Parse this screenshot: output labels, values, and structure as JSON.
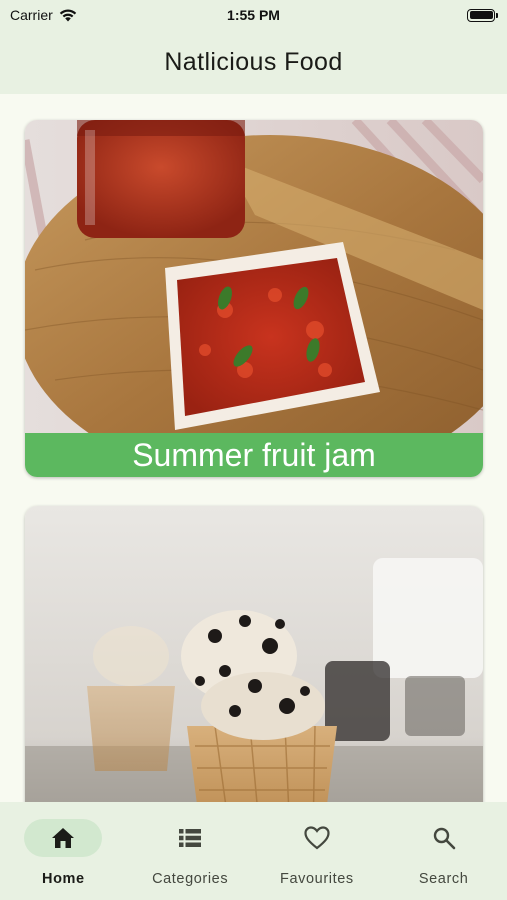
{
  "status_bar": {
    "carrier": "Carrier",
    "time": "1:55 PM",
    "icons": [
      "wifi-icon",
      "battery-icon"
    ]
  },
  "app_bar": {
    "title": "Natlicious Food"
  },
  "recipes": [
    {
      "title": "Summer fruit jam",
      "image": "strawberry jam on toast photo"
    },
    {
      "title": "",
      "image": "cookies and cream ice cream cone photo"
    }
  ],
  "bottom_nav": {
    "items": [
      {
        "label": "Home",
        "icon": "home-icon",
        "active": true
      },
      {
        "label": "Categories",
        "icon": "list-icon",
        "active": false
      },
      {
        "label": "Favourites",
        "icon": "heart-icon",
        "active": false
      },
      {
        "label": "Search",
        "icon": "search-icon",
        "active": false
      }
    ]
  },
  "colors": {
    "app_bar": "#e8f1e2",
    "background": "#f8faf1",
    "caption_green": "#5cb85f",
    "active_pill": "#d2e8cf"
  }
}
